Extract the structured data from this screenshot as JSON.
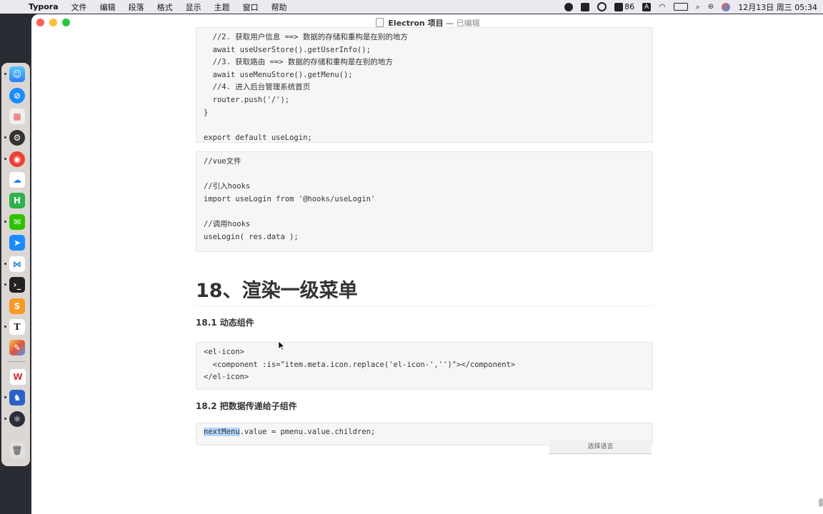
{
  "menubar": {
    "app": "Typora",
    "items": [
      "文件",
      "编辑",
      "段落",
      "格式",
      "显示",
      "主题",
      "窗口",
      "帮助"
    ],
    "battery_text": "86",
    "input_badge": "A",
    "clock": "12月13日 周三  05:34"
  },
  "window": {
    "title": "Electron 项目",
    "separator": "—",
    "status": "已编辑"
  },
  "code_block_1": {
    "lines": [
      "  //2. 获取用户信息 ==> 数据的存储和重构是在别的地方",
      "  await useUserStore().getUserInfo();",
      "  //3. 获取路由 ==> 数据的存储和重构是在别的地方",
      "  await useMenuStore().getMenu();",
      "  //4. 进入后台管理系统首页",
      "  router.push('/');",
      "}",
      "",
      "export default useLogin;"
    ]
  },
  "code_block_2": {
    "lines": [
      "//vue文件",
      "",
      "//引入hooks",
      "import useLogin from '@hooks/useLogin'",
      "",
      "//调用hooks",
      "useLogin( res.data );"
    ]
  },
  "heading_18": "18、渲染一级菜单",
  "heading_18_1": "18.1 动态组件",
  "code_block_3": {
    "lines": [
      "<el-icon>",
      "  <component :is=\"item.meta.icon.replace('el-icon-','')\"></component>",
      "</el-icon>"
    ]
  },
  "heading_18_2": "18.2 把数据传递给子组件",
  "code_block_4": {
    "selected": "nextMenu",
    "rest": ".value = pmenu.value.children;"
  },
  "language_picker": "选择语言",
  "dock": {
    "apps": [
      "finder-icon",
      "safari-icon",
      "launchpad-icon",
      "system-prefs-icon",
      "chrome-icon",
      "baidu-netdisk-icon",
      "hbuilder-icon",
      "wechat-icon",
      "feishu-icon",
      "vscode-icon",
      "terminal-icon",
      "sublime-icon",
      "typora-icon",
      "paint-icon",
      "wps-icon",
      "clash-icon",
      "electron-icon",
      "trash-icon"
    ]
  }
}
